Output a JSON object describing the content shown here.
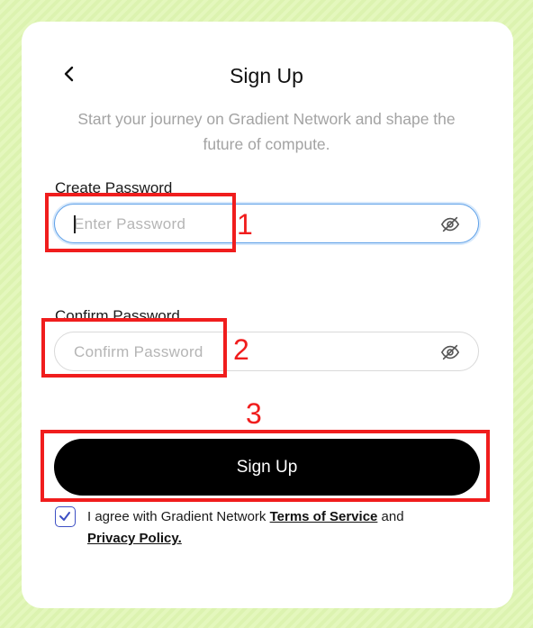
{
  "header": {
    "title": "Sign Up",
    "subtitle": "Start your journey on Gradient Network and shape the future of compute."
  },
  "form": {
    "create_password": {
      "label": "Create Password",
      "placeholder": "Enter Password",
      "value": ""
    },
    "confirm_password": {
      "label": "Confirm Password",
      "placeholder": "Confirm Password",
      "value": ""
    },
    "submit_label": "Sign Up",
    "agreement": {
      "checked": true,
      "prefix": "I agree with Gradient Network",
      "terms_link": "Terms of Service",
      "conjunction": "and",
      "privacy_link": "Privacy Policy."
    }
  },
  "annotations": {
    "marker_1": "1",
    "marker_2": "2",
    "marker_3": "3",
    "color": "#f01d1d"
  },
  "icons": {
    "back": "chevron-left-icon",
    "password_visibility": "eye-off-icon",
    "checkbox": "check-icon"
  },
  "colors": {
    "background": "#e4f7bd",
    "card": "#ffffff",
    "button": "#000000",
    "focus_border": "#5ea0e8",
    "checkbox_accent": "#3d4fc4"
  }
}
